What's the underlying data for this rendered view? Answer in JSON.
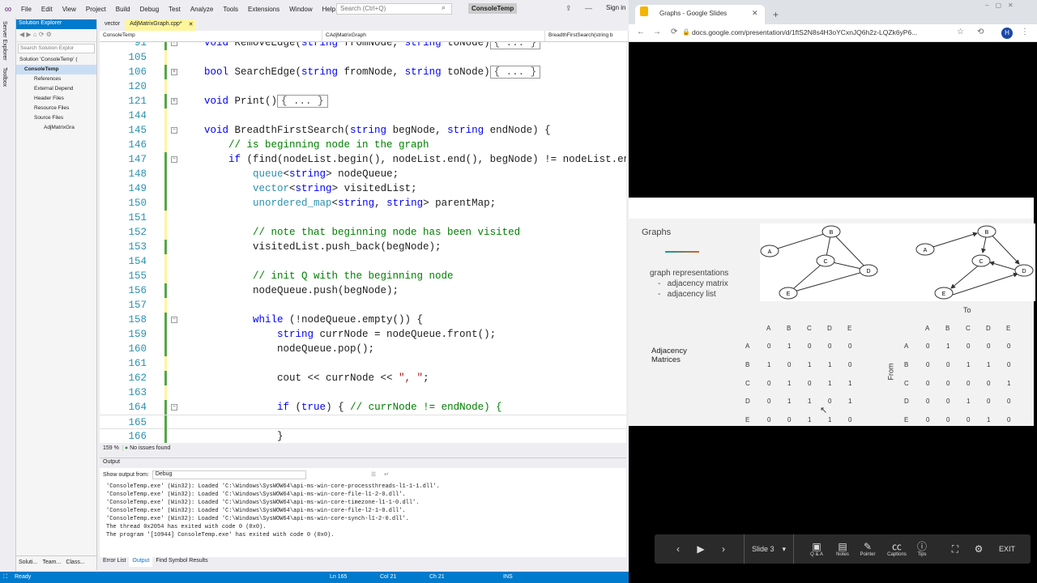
{
  "vs": {
    "menu": [
      "File",
      "Edit",
      "View",
      "Project",
      "Build",
      "Debug",
      "Test",
      "Analyze",
      "Tools",
      "Extensions",
      "Window",
      "Help"
    ],
    "search_placeholder": "Search (Ctrl+Q)",
    "project_title": "ConsoleTemp",
    "sign_in": "Sign in",
    "side_tabs": [
      "Server Explorer",
      "Toolbox"
    ],
    "solution_explorer": {
      "title": "Solution Explorer",
      "search_placeholder": "Search Solution Explor",
      "tree": [
        "Solution 'ConsoleTemp' (",
        "ConsoleTemp",
        "References",
        "External Depend",
        "Header Files",
        "Resource Files",
        "Source Files",
        "AdjMatrixGra"
      ],
      "bottom_tabs": [
        "Soluti...",
        "Team...",
        "Class..."
      ]
    },
    "doc_tabs": [
      "vector",
      "AdjMatrixGraph.cpp*"
    ],
    "nav": [
      "ConsoleTemp",
      "CAdjMatrixGraph",
      "BreadthFirstSearch(string b"
    ],
    "code_lines": [
      {
        "n": "91",
        "html": "<span class='kw'>void</span> RemoveEdge(<span class='kw'>string</span> fromNode, <span class='kw'>string</span> toNode)<span class='coll'>{ ... }</span>"
      },
      {
        "n": "105",
        "html": ""
      },
      {
        "n": "106",
        "html": "<span class='kw'>bool</span> SearchEdge(<span class='kw'>string</span> fromNode, <span class='kw'>string</span> toNode)<span class='coll'>{ ... }</span>"
      },
      {
        "n": "120",
        "html": ""
      },
      {
        "n": "121",
        "html": "<span class='kw'>void</span> Print()<span class='coll'>{ ... }</span>"
      },
      {
        "n": "144",
        "html": ""
      },
      {
        "n": "145",
        "html": "<span class='kw'>void</span> BreadthFirstSearch(<span class='kw'>string</span> begNode, <span class='kw'>string</span> endNode) {"
      },
      {
        "n": "146",
        "html": "    <span class='cm'>// is beginning node in the graph</span>"
      },
      {
        "n": "147",
        "html": "    <span class='kw'>if</span> (find(nodeList.begin(), nodeList.end(), begNode) != nodeList.end"
      },
      {
        "n": "148",
        "html": "        <span class='ty'>queue</span>&lt;<span class='kw'>string</span>&gt; nodeQueue;"
      },
      {
        "n": "149",
        "html": "        <span class='ty'>vector</span>&lt;<span class='kw'>string</span>&gt; visitedList;"
      },
      {
        "n": "150",
        "html": "        <span class='ty'>unordered_map</span>&lt;<span class='kw'>string</span>, <span class='kw'>string</span>&gt; parentMap;"
      },
      {
        "n": "151",
        "html": ""
      },
      {
        "n": "152",
        "html": "        <span class='cm'>// note that beginning node has been visited</span>"
      },
      {
        "n": "153",
        "html": "        visitedList.push_back(begNode);"
      },
      {
        "n": "154",
        "html": ""
      },
      {
        "n": "155",
        "html": "        <span class='cm'>// init Q with the beginning node</span>"
      },
      {
        "n": "156",
        "html": "        nodeQueue.push(begNode);"
      },
      {
        "n": "157",
        "html": ""
      },
      {
        "n": "158",
        "html": "        <span class='kw'>while</span> (!nodeQueue.empty()) {"
      },
      {
        "n": "159",
        "html": "            <span class='kw'>string</span> currNode = nodeQueue.front();"
      },
      {
        "n": "160",
        "html": "            nodeQueue.pop();"
      },
      {
        "n": "161",
        "html": ""
      },
      {
        "n": "162",
        "html": "            cout &lt;&lt; currNode &lt;&lt; <span class='st'>\", \"</span>;"
      },
      {
        "n": "163",
        "html": ""
      },
      {
        "n": "164",
        "html": "            <span class='kw'>if</span> (<span class='kw'>true</span>) { <span class='cm'>// currNode != endNode) {</span>"
      },
      {
        "n": "165",
        "html": ""
      },
      {
        "n": "166",
        "html": "            }"
      }
    ],
    "zoom": "159 %",
    "issues": "No issues found",
    "output": {
      "title": "Output",
      "show_from_label": "Show output from:",
      "show_from_value": "Debug",
      "lines": [
        "'ConsoleTemp.exe' (Win32): Loaded 'C:\\Windows\\SysWOW64\\api-ms-win-core-processthreads-l1-1-1.dll'.",
        "'ConsoleTemp.exe' (Win32): Loaded 'C:\\Windows\\SysWOW64\\api-ms-win-core-file-l1-2-0.dll'.",
        "'ConsoleTemp.exe' (Win32): Loaded 'C:\\Windows\\SysWOW64\\api-ms-win-core-timezone-l1-1-0.dll'.",
        "'ConsoleTemp.exe' (Win32): Loaded 'C:\\Windows\\SysWOW64\\api-ms-win-core-file-l2-1-0.dll'.",
        "'ConsoleTemp.exe' (Win32): Loaded 'C:\\Windows\\SysWOW64\\api-ms-win-core-synch-l1-2-0.dll'.",
        "The thread 0x2054 has exited with code 0 (0x0).",
        "The program '[10944] ConsoleTemp.exe' has exited with code 0 (0x0)."
      ]
    },
    "bottom_tabs": [
      "Error List",
      "Output",
      "Find Symbol Results"
    ],
    "status": {
      "ready": "Ready",
      "ln": "Ln 165",
      "col": "Col 21",
      "ch": "Ch 21",
      "ins": "INS"
    }
  },
  "chrome": {
    "tab_title": "Graphs - Google Slides",
    "url": "docs.google.com/presentation/d/1ftS2N8s4H3oYCxnJQ6h2z-LQZk6yP6...",
    "avatar": "H",
    "slide": {
      "title": "Graphs",
      "reps_heading": "graph representations",
      "reps": [
        "adjacency matrix",
        "adjacency list"
      ],
      "adj_label": "Adjacency Matrices",
      "to_label": "To",
      "from_label": "From",
      "node_labels": [
        "A",
        "B",
        "C",
        "D",
        "E"
      ],
      "undirected_matrix": [
        [
          0,
          1,
          0,
          0,
          0
        ],
        [
          1,
          0,
          1,
          1,
          0
        ],
        [
          0,
          1,
          0,
          1,
          1
        ],
        [
          0,
          1,
          1,
          0,
          1
        ],
        [
          0,
          0,
          1,
          1,
          0
        ]
      ],
      "directed_matrix": [
        [
          0,
          1,
          0,
          0,
          0
        ],
        [
          0,
          0,
          1,
          1,
          0
        ],
        [
          0,
          0,
          0,
          0,
          1
        ],
        [
          0,
          0,
          1,
          0,
          0
        ],
        [
          0,
          0,
          0,
          1,
          0
        ]
      ]
    },
    "pres_bar": {
      "slide": "Slide 3",
      "qa": "Q & A",
      "notes": "Notes",
      "pointer": "Pointer",
      "captions": "Captions",
      "tips": "Tips",
      "exit": "EXIT"
    }
  }
}
